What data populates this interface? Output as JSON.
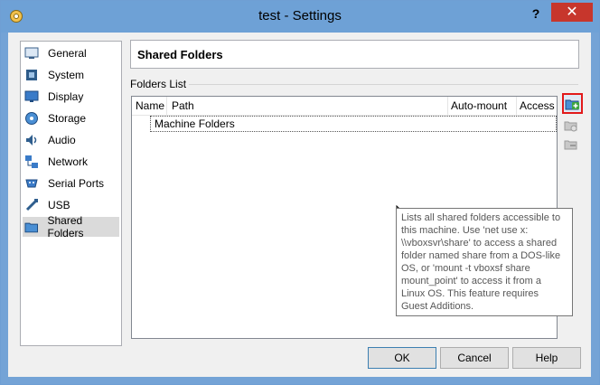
{
  "window": {
    "title": "test - Settings",
    "help_label": "?",
    "close_label": "✕"
  },
  "sidebar": {
    "items": [
      {
        "label": "General",
        "icon": "general-icon"
      },
      {
        "label": "System",
        "icon": "system-icon"
      },
      {
        "label": "Display",
        "icon": "display-icon"
      },
      {
        "label": "Storage",
        "icon": "storage-icon"
      },
      {
        "label": "Audio",
        "icon": "audio-icon"
      },
      {
        "label": "Network",
        "icon": "network-icon"
      },
      {
        "label": "Serial Ports",
        "icon": "serial-ports-icon"
      },
      {
        "label": "USB",
        "icon": "usb-icon"
      },
      {
        "label": "Shared Folders",
        "icon": "shared-folders-icon",
        "selected": true
      }
    ]
  },
  "page": {
    "title": "Shared Folders",
    "group_label": "Folders List"
  },
  "table": {
    "columns": [
      "Name",
      "Path",
      "Auto-mount",
      "Access"
    ],
    "rows": [
      "Machine Folders"
    ]
  },
  "tooltip": {
    "text": "Lists all shared folders accessible to this machine. Use 'net use x: \\\\vboxsvr\\share' to access a shared folder named share from a DOS-like OS, or 'mount -t vboxsf share mount_point' to access it from a Linux OS. This feature requires Guest Additions."
  },
  "buttons": {
    "ok": "OK",
    "cancel": "Cancel",
    "help": "Help"
  },
  "colors": {
    "accent": "#6ea1d6",
    "close": "#c7362c",
    "highlight": "#e21a1a"
  }
}
